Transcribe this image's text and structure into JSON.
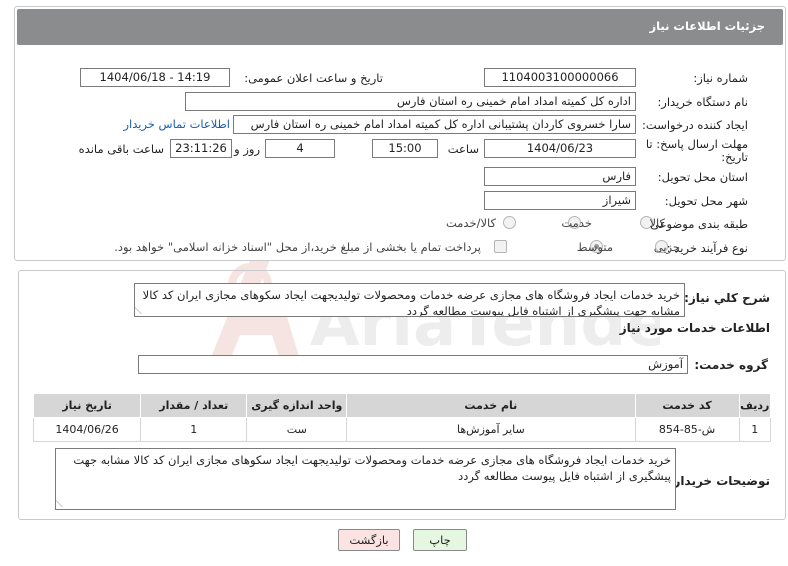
{
  "header": {
    "title": "جزئیات اطلاعات نیاز"
  },
  "fields": {
    "need_number": {
      "label": "شماره نیاز:",
      "value": "1104003100000066"
    },
    "announce": {
      "label": "تاریخ و ساعت اعلان عمومی:",
      "value": "1404/06/18 - 14:19"
    },
    "buyer_org": {
      "label": "نام دستگاه خریدار:",
      "value": "اداره کل کمیته امداد امام خمینی  ره  استان فارس"
    },
    "requester": {
      "label": "ایجاد کننده درخواست:",
      "value": "سارا خسروی کاردان پشتیبانی  اداره کل کمیته امداد امام خمینی  ره  استان فارس",
      "contact_link": "اطلاعات تماس خریدار"
    },
    "deadline": {
      "label_line1": "مهلت ارسال پاسخ: تا",
      "label_line2": "تاریخ:",
      "date": "1404/06/23",
      "time_label": "ساعت",
      "time": "15:00",
      "days": "4",
      "days_label": "روز و",
      "remaining": "23:11:26",
      "remaining_label": "ساعت باقی مانده"
    },
    "province": {
      "label": "استان محل تحویل:",
      "value": "فارس"
    },
    "city": {
      "label": "شهر محل تحویل:",
      "value": "شیراز"
    },
    "category": {
      "label": "طبقه بندی موضوعی:",
      "options": [
        "کالا",
        "خدمت",
        "کالا/خدمت"
      ]
    },
    "process": {
      "label": "نوع فرآیند خرید :",
      "options": [
        "جزیی",
        "متوسط"
      ],
      "payment_note": "پرداخت تمام یا بخشی از مبلغ خرید،از محل \"اسناد خزانه اسلامی\" خواهد بود."
    }
  },
  "summary": {
    "label": "شرح کلي نياز:",
    "text": "خرید خدمات ایجاد فروشگاه های مجازی عرضه خدمات ومحصولات تولیدیجهت ایجاد سکوهای مجازی ایران کد کالا مشابه جهت پیشگیری از اشتباه فایل پیوست مطالعه گردد"
  },
  "services": {
    "section_title": "اطلاعات خدمات مورد نیاز",
    "group_label": "گروه خدمت:",
    "group_value": "آموزش",
    "columns": [
      "ردیف",
      "کد خدمت",
      "نام خدمت",
      "واحد اندازه گیری",
      "تعداد / مقدار",
      "تاریخ نیاز"
    ],
    "rows": [
      {
        "row": "1",
        "code": "ش-85-854",
        "name": "سایر آموزش‌ها",
        "unit": "ست",
        "qty": "1",
        "date": "1404/06/26"
      }
    ]
  },
  "buyer_notes": {
    "label": "توضیحات خریدار:",
    "text": "خرید خدمات ایجاد فروشگاه های مجازی عرضه خدمات ومحصولات تولیدیجهت ایجاد سکوهای مجازی ایران کد کالا مشابه جهت پیشگیری از اشتباه فایل پیوست مطالعه گردد"
  },
  "buttons": {
    "print": "چاپ",
    "back": "بازگشت"
  },
  "colors": {
    "header_bg": "#8a8c8d",
    "link": "#1a5fb4",
    "back_bg": "#fbe3e3",
    "print_bg": "#e6f7e1"
  },
  "watermark_text": "AriaTender.neT"
}
